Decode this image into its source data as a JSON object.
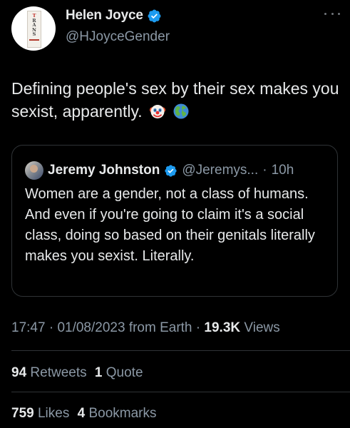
{
  "author": {
    "name": "Helen Joyce",
    "handle": "@HJoyceGender",
    "avatar_book_letters": [
      "T",
      "R",
      "A",
      "N",
      "S"
    ],
    "avatar_book_author": "HELEN JOYCE",
    "verified": true
  },
  "tweet": {
    "text": "Defining people's sex by their sex makes you sexist, apparently.",
    "emojis": [
      "clown-face-emoji",
      "globe-emoji"
    ]
  },
  "quoted": {
    "name": "Jeremy Johnston",
    "handle": "@Jeremys...",
    "separator": "·",
    "time": "10h",
    "verified": true,
    "text": "Women are a gender, not a class of humans. And even if you're going to claim it's a social class, doing so based on their genitals literally makes you sexist. Literally."
  },
  "meta": {
    "time": "17:47",
    "separator": "·",
    "date": "01/08/2023",
    "source": "from Earth",
    "views_count": "19.3K",
    "views_label": "Views"
  },
  "stats": {
    "retweets_count": "94",
    "retweets_label": "Retweets",
    "quotes_count": "1",
    "quotes_label": "Quote",
    "likes_count": "759",
    "likes_label": "Likes",
    "bookmarks_count": "4",
    "bookmarks_label": "Bookmarks"
  },
  "colors": {
    "background": "#000000",
    "text": "#e7e9ea",
    "secondary": "#8b98a5",
    "border": "#2f3336",
    "verified": "#1d9bf0"
  },
  "icons": {
    "more": "more-options-icon",
    "verified": "verified-badge-icon"
  }
}
